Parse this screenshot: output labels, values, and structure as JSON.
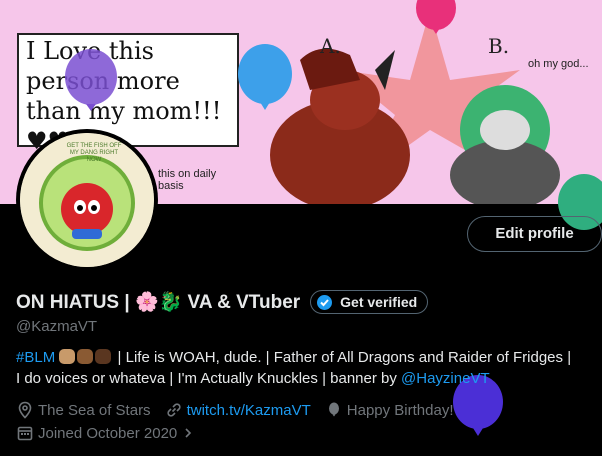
{
  "banner": {
    "speech_text": "I Love this person more than my mom!!! ♥♥♥",
    "label_a": "A.",
    "label_b": "B.",
    "side_note": "oh my god...",
    "bottom_note": "this on daily basis",
    "avatar_caption": "GET THE FISH OFF MY DANG RIGHT NOW"
  },
  "profile": {
    "edit_button": "Edit profile",
    "display_name": "ON HIATUS | 🌸🐉 VA & VTuber",
    "verify_button": "Get verified",
    "handle": "@KazmaVT",
    "bio": {
      "hashtag": "#BLM",
      "line1_rest": "| Life is WOAH, dude. | Father of All Dragons and Raider of Fridges |",
      "line2_text": "I do voices or whateva | I'm Actually Knuckles | banner by",
      "banner_credit": "@HayzineVT"
    },
    "location": "The Sea of Stars",
    "website": "twitch.tv/KazmaVT",
    "birthday": "Happy Birthday!",
    "joined": "Joined October 2020"
  },
  "colors": {
    "accent": "#1d9bf0",
    "muted": "#71767b",
    "banner_bg": "#f6c6ea",
    "text": "#e7e9ea"
  },
  "icons": {
    "location": "location-pin-icon",
    "website": "link-icon",
    "birthday": "balloon-icon",
    "joined": "calendar-icon",
    "verified": "verified-check-icon"
  }
}
